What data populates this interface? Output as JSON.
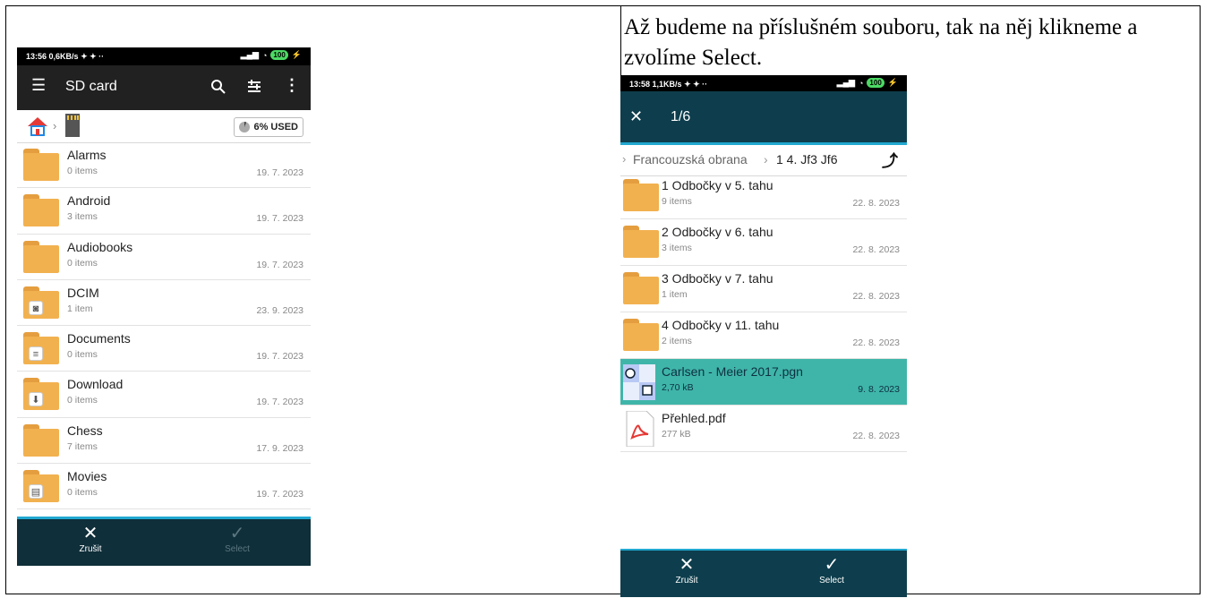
{
  "caption": "Až budeme na příslušném souboru, tak na něj klikneme a zvolíme Select.",
  "phone1": {
    "status": {
      "time": "13:56",
      "speed": "0,6KB/s",
      "battery": "100"
    },
    "appbar": {
      "title": "SD card",
      "menu_icon": "menu-icon",
      "search_icon": "search-icon",
      "filter_icon": "filter-icon",
      "more_icon": "more-vert-icon"
    },
    "crumbs": {
      "home_icon": "home-icon",
      "sd_icon": "sd-card-icon",
      "used": "6% USED"
    },
    "items": [
      {
        "name": "Alarms",
        "sub": "0 items",
        "date": "19. 7. 2023",
        "emblem": ""
      },
      {
        "name": "Android",
        "sub": "3 items",
        "date": "19. 7. 2023",
        "emblem": ""
      },
      {
        "name": "Audiobooks",
        "sub": "0 items",
        "date": "19. 7. 2023",
        "emblem": ""
      },
      {
        "name": "DCIM",
        "sub": "1 item",
        "date": "23. 9. 2023",
        "emblem": "camera"
      },
      {
        "name": "Documents",
        "sub": "0 items",
        "date": "19. 7. 2023",
        "emblem": "document"
      },
      {
        "name": "Download",
        "sub": "0 items",
        "date": "19. 7. 2023",
        "emblem": "download"
      },
      {
        "name": "Chess",
        "sub": "7 items",
        "date": "17. 9. 2023",
        "emblem": ""
      },
      {
        "name": "Movies",
        "sub": "0 items",
        "date": "19. 7. 2023",
        "emblem": "movie"
      }
    ],
    "bottom": {
      "cancel": "Zrušit",
      "select": "Select"
    }
  },
  "phone2": {
    "status": {
      "time": "13:58",
      "speed": "1,1KB/s",
      "battery": "100"
    },
    "appbar": {
      "title": "1/6",
      "close_icon": "close-icon"
    },
    "crumbs": {
      "path": "Francouzská obrana",
      "current": "1 4. Jf3 Jf6",
      "up_icon": "up-arrow-icon"
    },
    "items": [
      {
        "name": "1 Odbočky v 5. tahu",
        "sub": "9 items",
        "date": "22. 8. 2023",
        "type": "folder"
      },
      {
        "name": "2 Odbočky v 6. tahu",
        "sub": "3 items",
        "date": "22. 8. 2023",
        "type": "folder"
      },
      {
        "name": "3 Odbočky v 7. tahu",
        "sub": "1 item",
        "date": "22. 8. 2023",
        "type": "folder"
      },
      {
        "name": "4 Odbočky v 11. tahu",
        "sub": "2 items",
        "date": "22. 8. 2023",
        "type": "folder"
      },
      {
        "name": "Carlsen - Meier 2017.pgn",
        "sub": "2,70 kB",
        "date": "9. 8. 2023",
        "type": "pgn",
        "selected": true
      },
      {
        "name": "Přehled.pdf",
        "sub": "277 kB",
        "date": "22. 8. 2023",
        "type": "pdf"
      }
    ],
    "bottom": {
      "cancel": "Zrušit",
      "select": "Select"
    }
  }
}
